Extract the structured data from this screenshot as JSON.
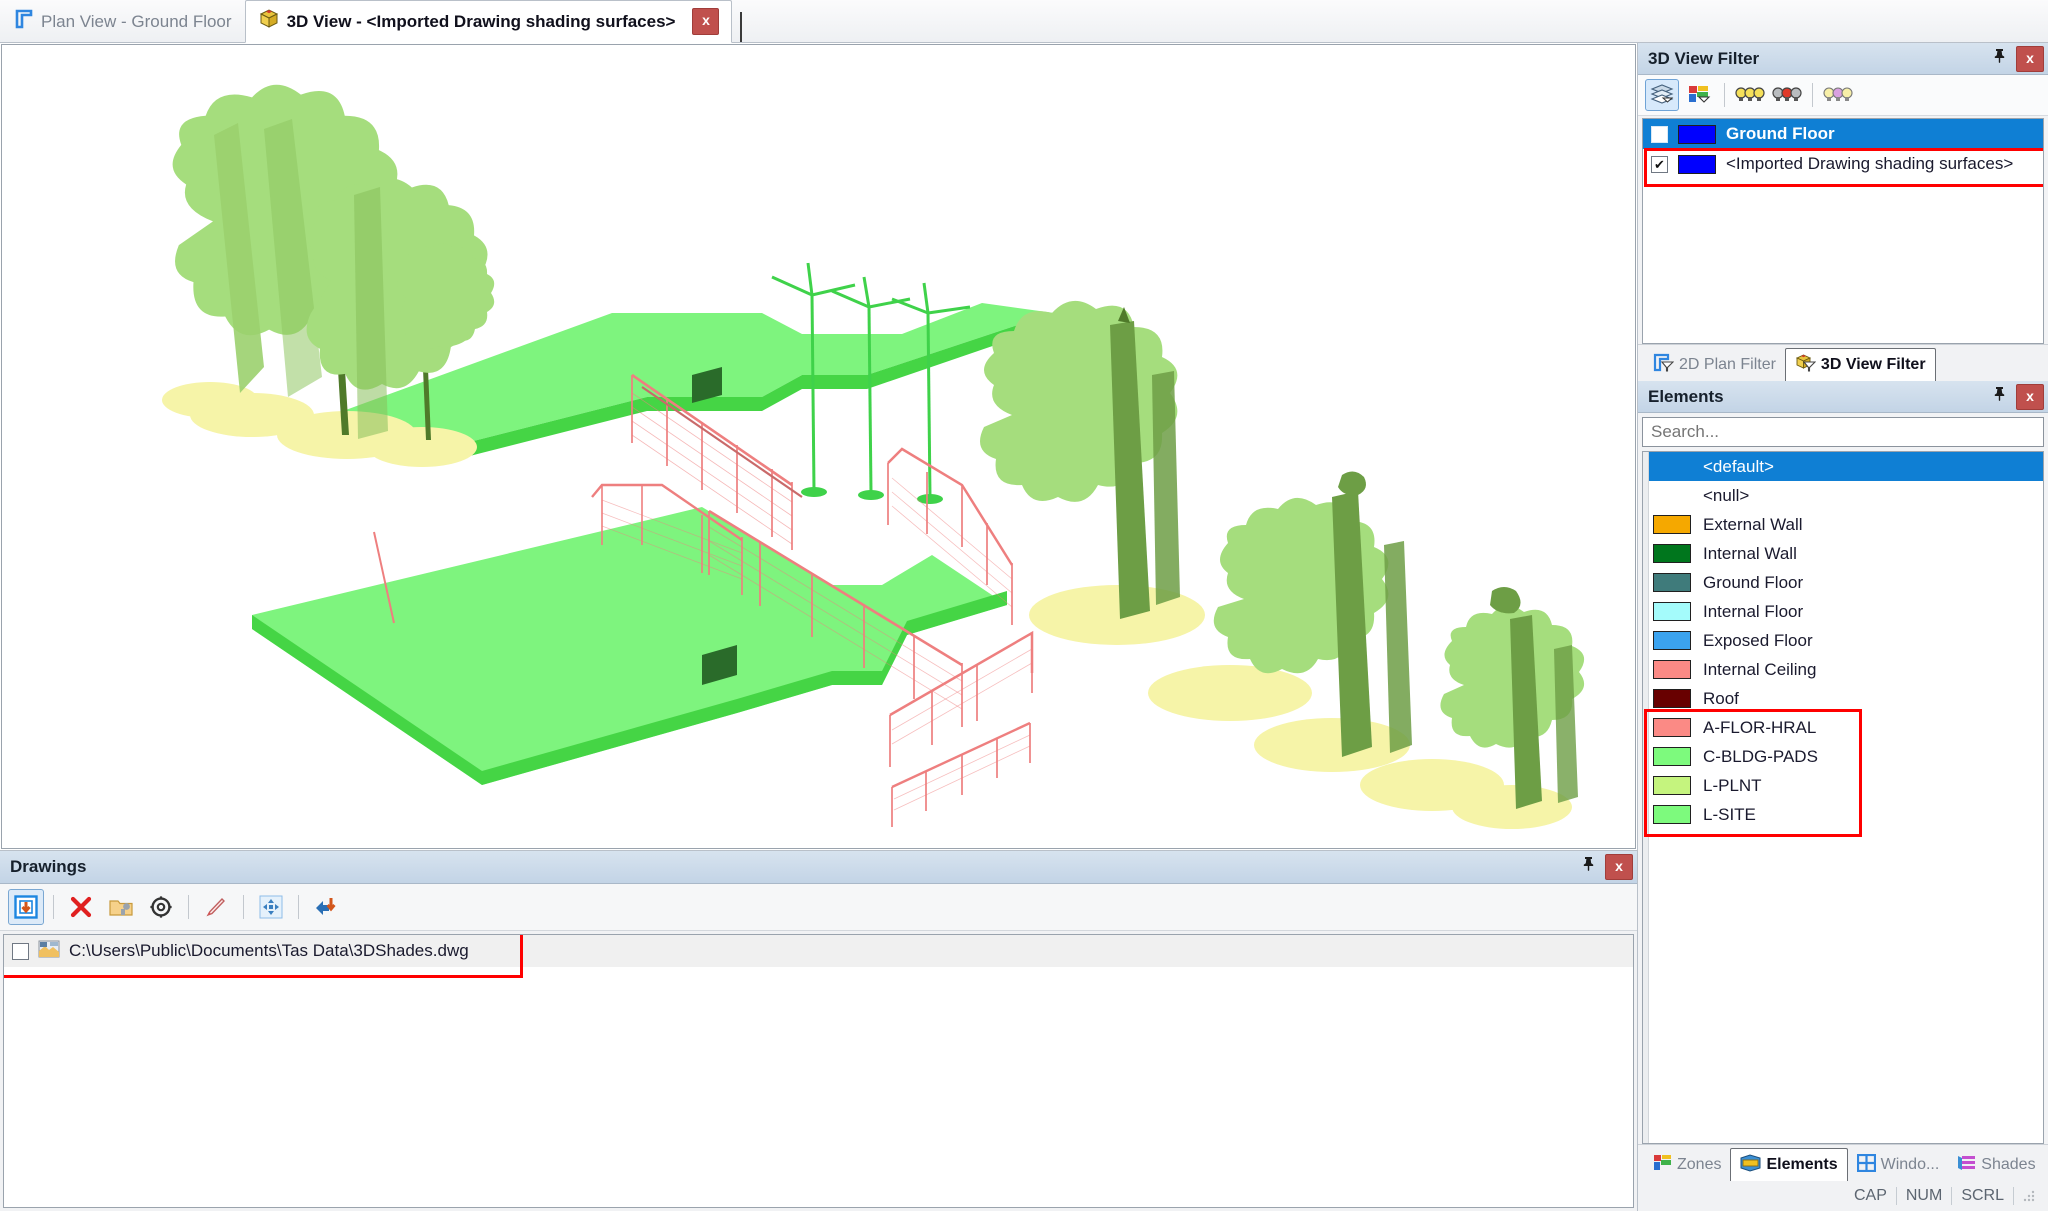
{
  "tabs": [
    {
      "label": "Plan View - Ground Floor",
      "icon": "plan-view-icon",
      "active": false
    },
    {
      "label": "3D View - <Imported Drawing shading surfaces>",
      "icon": "cube-icon",
      "active": true
    }
  ],
  "tab_close_label": "x",
  "view_filter": {
    "title": "3D View Filter",
    "pin_label": "丬",
    "close_label": "x",
    "toolbar": [
      {
        "name": "layers-filter-icon",
        "selected": true
      },
      {
        "name": "zones-filter-icon",
        "selected": false
      },
      {
        "name": "all-lights-icon",
        "selected": false
      },
      {
        "name": "mixed-lights-icon",
        "selected": false
      },
      {
        "name": "pale-lights-icon",
        "selected": false
      }
    ],
    "rows": [
      {
        "label": "Ground Floor",
        "checked": false,
        "color": "#0000ff",
        "selected": true
      },
      {
        "label": "<Imported Drawing shading surfaces>",
        "checked": true,
        "color": "#0000ff",
        "selected": false,
        "highlighted": true
      }
    ],
    "tabs": [
      {
        "label": "2D Plan Filter",
        "icon": "plan-filter-icon",
        "active": false
      },
      {
        "label": "3D View Filter",
        "icon": "view-filter-icon",
        "active": true
      }
    ]
  },
  "elements": {
    "title": "Elements",
    "pin_label": "丬",
    "close_label": "x",
    "search_placeholder": "Search...",
    "search_value": "",
    "items": [
      {
        "label": "<default>",
        "color": null,
        "selected": true
      },
      {
        "label": "<null>",
        "color": null,
        "selected": false
      },
      {
        "label": "External Wall",
        "color": "#f5a800",
        "selected": false
      },
      {
        "label": "Internal Wall",
        "color": "#00761d",
        "selected": false
      },
      {
        "label": "Ground Floor",
        "color": "#3f7b7b",
        "selected": false
      },
      {
        "label": "Internal Floor",
        "color": "#a4fbfb",
        "selected": false
      },
      {
        "label": "Exposed Floor",
        "color": "#3ba3ef",
        "selected": false
      },
      {
        "label": "Internal Ceiling",
        "color": "#fb8a85",
        "selected": false
      },
      {
        "label": "Roof",
        "color": "#680000",
        "selected": false
      },
      {
        "label": "A-FLOR-HRAL",
        "color": "#fb8a85",
        "selected": false,
        "highlighted": true
      },
      {
        "label": "C-BLDG-PADS",
        "color": "#7dfa7d",
        "selected": false,
        "highlighted": true
      },
      {
        "label": "L-PLNT",
        "color": "#c5f47e",
        "selected": false,
        "highlighted": true
      },
      {
        "label": "L-SITE",
        "color": "#7dfa7d",
        "selected": false,
        "highlighted": true
      }
    ],
    "tabs": [
      {
        "label": "Zones",
        "icon": "zones-icon",
        "active": false
      },
      {
        "label": "Elements",
        "icon": "elements-icon",
        "active": true
      },
      {
        "label": "Windo...",
        "icon": "windows-icon",
        "active": false
      },
      {
        "label": "Shades",
        "icon": "shades-icon",
        "active": false
      }
    ]
  },
  "drawings": {
    "title": "Drawings",
    "pin_label": "丬",
    "close_label": "x",
    "toolbar": [
      {
        "name": "import-drawing-icon",
        "selected": true
      },
      {
        "name": "delete-icon",
        "selected": false
      },
      {
        "name": "open-folder-icon",
        "selected": false
      },
      {
        "name": "settings-gear-icon",
        "selected": false
      },
      {
        "name": "pen-icon",
        "selected": false
      },
      {
        "name": "move-icon",
        "selected": false
      },
      {
        "name": "export-icon",
        "selected": false
      }
    ],
    "rows": [
      {
        "path": "C:\\Users\\Public\\Documents\\Tas Data\\3DShades.dwg",
        "checked": false,
        "icon": "dwg-file-icon"
      }
    ]
  },
  "statusbar": {
    "items": [
      "CAP",
      "NUM",
      "SCRL"
    ]
  },
  "viewport": {
    "name": "3d-view-canvas",
    "background": "#ffffff",
    "colors": {
      "pad_top": "#7ef47e",
      "pad_side": "#45d545",
      "pad_edge_dark": "#2a6b2a",
      "tree_light": "#a5dd7d",
      "tree_mid": "#9bd06e",
      "tree_dark": "#6d9e45",
      "shadow": "#f6f4a8",
      "fence": "#ee7f7f",
      "fence_dark": "#b85858",
      "turbine": "#3fd24a"
    }
  }
}
